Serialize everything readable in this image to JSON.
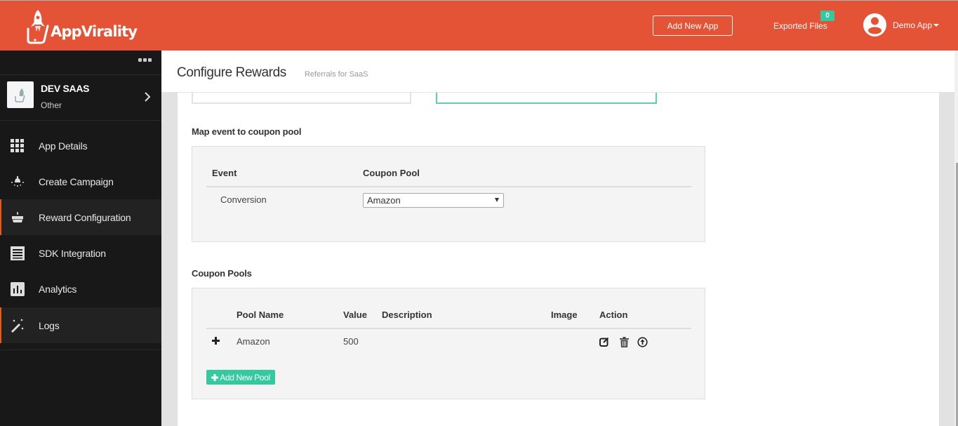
{
  "header": {
    "brand": "AppVirality",
    "add_app_label": "Add New App",
    "exported_files_label": "Exported Files",
    "exported_files_count": "0",
    "user_name": "Demo App",
    "brand_color": "#e55336",
    "badge_color": "#34c99e"
  },
  "sidebar": {
    "app": {
      "name": "DEV SAAS",
      "type": "Other"
    },
    "items": [
      {
        "label": "App Details",
        "icon": "grid-icon",
        "active": false
      },
      {
        "label": "Create Campaign",
        "icon": "lightbulb-icon",
        "active": false
      },
      {
        "label": "Reward Configuration",
        "icon": "cake-icon",
        "active": true
      },
      {
        "label": "SDK Integration",
        "icon": "document-icon",
        "active": false
      },
      {
        "label": "Analytics",
        "icon": "bar-chart-icon",
        "active": false
      },
      {
        "label": "Logs",
        "icon": "magic-wand-icon",
        "active": true
      }
    ],
    "active_accent": "#e55c1a"
  },
  "page": {
    "title": "Configure Rewards",
    "subtitle": "Referrals for SaaS"
  },
  "event_map": {
    "section_title": "Map event to coupon pool",
    "columns": [
      "Event",
      "Coupon Pool"
    ],
    "rows": [
      {
        "event": "Conversion",
        "coupon_pool": "Amazon"
      }
    ]
  },
  "coupon_pools": {
    "section_title": "Coupon Pools",
    "columns": [
      "Pool Name",
      "Value",
      "Description",
      "Image",
      "Action"
    ],
    "rows": [
      {
        "pool_name": "Amazon",
        "value": "500",
        "description": "",
        "image": "",
        "actions": [
          "edit-icon",
          "trash-icon",
          "upload-icon"
        ]
      }
    ],
    "add_button_label": "Add New Pool"
  }
}
